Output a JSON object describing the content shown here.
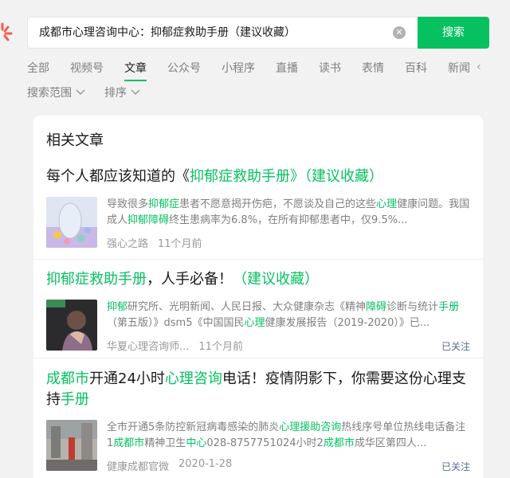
{
  "search": {
    "query": "成都市心理咨询中心：抑郁症救助手册（建议收藏）",
    "clear_icon": "close-circle-icon",
    "button_label": "搜索"
  },
  "tabs": [
    "全部",
    "视频号",
    "文章",
    "公众号",
    "小程序",
    "直播",
    "读书",
    "表情",
    "百科",
    "新闻"
  ],
  "active_tab": "文章",
  "filters": {
    "range_label": "搜索范围",
    "sort_label": "排序"
  },
  "section_title": "相关文章",
  "colors": {
    "accent": "#07c160",
    "link": "#576b95"
  },
  "articles": [
    {
      "title_parts": [
        {
          "t": "每个人都应该知道的《",
          "h": false
        },
        {
          "t": "抑郁症救助手册",
          "h": true
        },
        {
          "t": "》（建议收藏）",
          "h": true
        }
      ],
      "snippet_parts": [
        {
          "t": "导致很多",
          "h": false
        },
        {
          "t": "抑郁症",
          "h": true
        },
        {
          "t": "患者不愿意揭开伤疤，不愿谈及自己的这些",
          "h": false
        },
        {
          "t": "心理",
          "h": true
        },
        {
          "t": "健康问题。我国成人",
          "h": false
        },
        {
          "t": "抑郁障碍",
          "h": true
        },
        {
          "t": "终生患病率为6.8%，在所有抑郁患者中，仅9.5%...",
          "h": false
        }
      ],
      "source": "强心之路",
      "date": "11个月前",
      "followed": ""
    },
    {
      "title_parts": [
        {
          "t": "抑郁症救助手册",
          "h": true
        },
        {
          "t": "，人手必备！",
          "h": false
        },
        {
          "t": "（建议收藏）",
          "h": true
        }
      ],
      "snippet_parts": [
        {
          "t": "抑郁",
          "h": true
        },
        {
          "t": "研究所、光明新闻、人民日报、大众健康杂志《精神",
          "h": false
        },
        {
          "t": "障碍",
          "h": true
        },
        {
          "t": "诊断与统计",
          "h": false
        },
        {
          "t": "手册",
          "h": true
        },
        {
          "t": "（第五版）》dsm5《中国国民",
          "h": false
        },
        {
          "t": "心理",
          "h": true
        },
        {
          "t": "健康发展报告（2019-2020）》已...",
          "h": false
        }
      ],
      "source": "华夏心理咨询师...",
      "date": "11个月前",
      "followed": "已关注"
    },
    {
      "title_parts": [
        {
          "t": "成都市",
          "h": true
        },
        {
          "t": "开通24小时",
          "h": false
        },
        {
          "t": "心理咨询",
          "h": true
        },
        {
          "t": "电话！疫情阴影下，你需要这份心理支持",
          "h": false
        },
        {
          "t": "手册",
          "h": true
        }
      ],
      "snippet_parts": [
        {
          "t": "全市开通5条防控新冠病毒感染的肺炎",
          "h": false
        },
        {
          "t": "心理援助咨询",
          "h": true
        },
        {
          "t": "热线序号单位热线电话备注1",
          "h": false
        },
        {
          "t": "成都市",
          "h": true
        },
        {
          "t": "精神卫生",
          "h": false
        },
        {
          "t": "中心",
          "h": true
        },
        {
          "t": "028-8757751024小时2",
          "h": false
        },
        {
          "t": "成都市",
          "h": true
        },
        {
          "t": "成华区第四人...",
          "h": false
        }
      ],
      "source": "健康成都官微",
      "date": "2020-1-28",
      "followed": "已关注"
    }
  ]
}
